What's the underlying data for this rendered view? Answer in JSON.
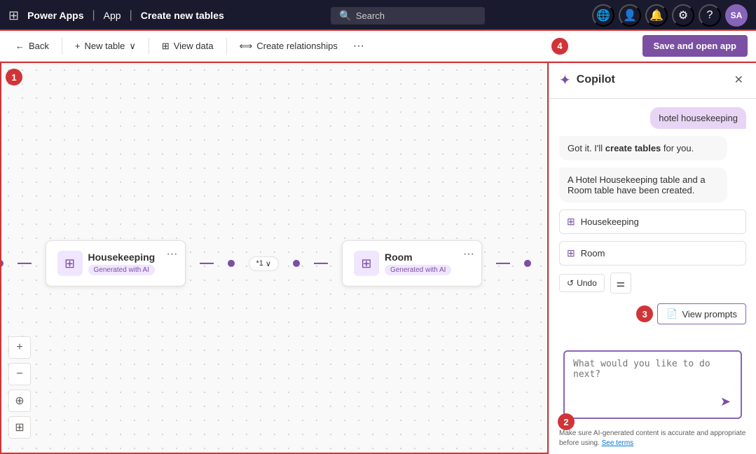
{
  "nav": {
    "app_name": "Power Apps",
    "separator1": "|",
    "breadcrumb_app": "App",
    "separator2": "|",
    "breadcrumb_page": "Create new tables",
    "search_placeholder": "Search"
  },
  "nav_icons": {
    "grid": "⊞",
    "globe": "🌐",
    "persona": "👤",
    "bell": "🔔",
    "gear": "⚙",
    "help": "?",
    "avatar_initials": "SA"
  },
  "toolbar": {
    "back_label": "Back",
    "new_table_label": "New table",
    "view_data_label": "View data",
    "create_relationships_label": "Create relationships",
    "more_label": "···",
    "save_btn_label": "Save and open app"
  },
  "canvas": {
    "tools": [
      "+",
      "−",
      "⊕",
      "⊞"
    ],
    "tool_names": [
      "zoom-in",
      "zoom-out",
      "fit",
      "map"
    ]
  },
  "tables": [
    {
      "name": "Housekeeping",
      "ai_badge": "Generated with AI"
    },
    {
      "name": "Room",
      "ai_badge": "Generated with AI"
    }
  ],
  "relationship": {
    "label": "*1",
    "chevron": "∨"
  },
  "copilot": {
    "title": "Copilot",
    "logo": "✦",
    "user_message": "hotel housekeeping",
    "bot_message1_prefix": "Got it. I'll ",
    "bot_message1_bold": "create tables",
    "bot_message1_suffix": " for you.",
    "bot_message2": "A Hotel Housekeeping table and a Room table have been created.",
    "table_refs": [
      "Housekeeping",
      "Room"
    ],
    "undo_label": "Undo",
    "view_prompts_label": "View prompts",
    "input_placeholder": "What would you like to do next?",
    "footer_text": "Make sure AI-generated content is accurate and appropriate before using. ",
    "footer_link": "See terms"
  },
  "step_badges": [
    "1",
    "2",
    "3",
    "4"
  ]
}
